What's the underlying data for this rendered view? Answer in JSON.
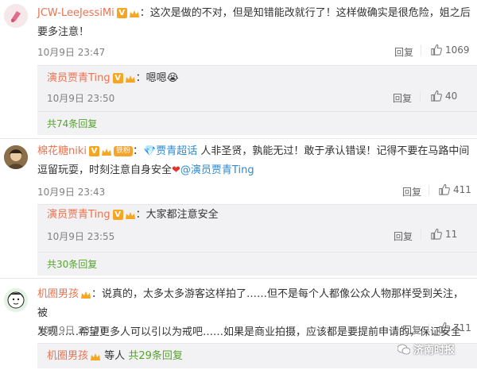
{
  "comments": [
    {
      "user": "JCW-LeeJessiMi",
      "text_line1": "：这次是做的不对，但是知错能改就行了！这样做确实是很危险，姐之后",
      "text_line2": "要多注意！",
      "date": "10月9日 23:47",
      "reply_label": "回复",
      "likes": "1069",
      "sub_reply": {
        "user": "演员贾青Ting",
        "text": "：嗯嗯",
        "emoji": "😭",
        "date": "10月9日 23:50",
        "reply_label": "回复",
        "likes": "40"
      },
      "more_label": "共74条回复"
    },
    {
      "user": "棉花糖niki",
      "fan_badge": "铁粉",
      "supertopic_icon": "💎",
      "supertopic": "贾青超话",
      "text_line1_after": "人非圣贤，孰能无过！敢于承认错误！记得不要在马路中间",
      "text_line2_start": "逗留玩耍，时刻注意自身安全",
      "mention": "@演员贾青Ting",
      "date": "10月9日 23:43",
      "reply_label": "回复",
      "likes": "411",
      "sub_reply": {
        "user": "演员贾青Ting",
        "text": "：大家都注意安全",
        "date": "10月9日 23:55",
        "reply_label": "回复",
        "likes": "11"
      },
      "more_label": "共30条回复"
    },
    {
      "user": "机圈男孩",
      "text_line1": "：说真的，太多太多游客这样拍了……但不是每个人都像公众人物那样受到关注，被",
      "text_line2": "发现……希望更多人可以引以为戒吧……如果是商业拍摄，应该都是要提前申请的，保证安全",
      "date": "10月9日 23:47",
      "reply_label": "回复",
      "likes": "711",
      "sub_reply": {
        "user": "机圈男孩",
        "text": "等人",
        "more_link": "共29条回复"
      }
    }
  ],
  "watermark": "济南时报",
  "colors": {
    "username": "#eb7350",
    "more_link": "#56a32e",
    "mention": "#2b8bd6",
    "subbox_bg": "#f2f2f5"
  }
}
